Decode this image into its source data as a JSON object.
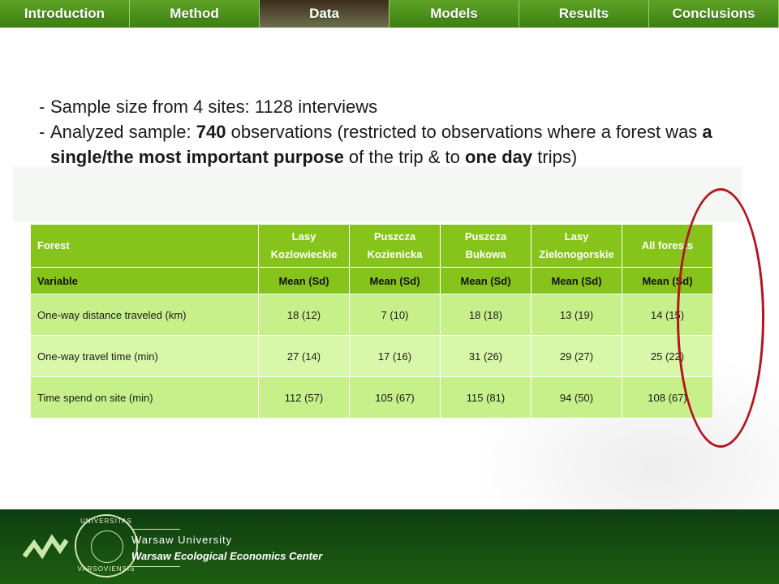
{
  "nav": {
    "tabs": [
      {
        "label": "Introduction"
      },
      {
        "label": "Method"
      },
      {
        "label": "Data"
      },
      {
        "label": "Models"
      },
      {
        "label": "Results"
      },
      {
        "label": "Conclusions"
      }
    ],
    "active_tab": "Data"
  },
  "bullets": {
    "b1": {
      "dash": "-",
      "text": "Sample size from 4 sites: 1128 interviews"
    },
    "b2": {
      "dash": "-",
      "p1": "Analyzed sample: ",
      "bold1": "740",
      "p2": " observations (restricted to observations where a forest was ",
      "bold2": "a single/the most important purpose",
      "p3": " of the trip & to ",
      "bold3": "one day",
      "p4": " trips)"
    }
  },
  "table": {
    "header": {
      "forest": "Forest",
      "cols": [
        {
          "l1": "Lasy",
          "l2": "Kozlowieckie"
        },
        {
          "l1": "Puszcza",
          "l2": "Kozienicka"
        },
        {
          "l1": "Puszcza",
          "l2": "Bukowa"
        },
        {
          "l1": "Lasy",
          "l2": "Zielonogorskie"
        },
        {
          "l1": "All forests",
          "l2": ""
        }
      ]
    },
    "subheader": {
      "variable": "Variable",
      "stats": [
        "Mean (Sd)",
        "Mean (Sd)",
        "Mean (Sd)",
        "Mean (Sd)",
        "Mean (Sd)"
      ]
    },
    "rows": [
      {
        "label": "One-way distance traveled (km)",
        "values": [
          "18 (12)",
          "7 (10)",
          "18 (18)",
          "13 (19)",
          "14 (15)"
        ]
      },
      {
        "label": "One-way travel time (min)",
        "values": [
          "27 (14)",
          "17 (16)",
          "31 (26)",
          "29 (27)",
          "25 (22)"
        ]
      },
      {
        "label": "Time spend on site (min)",
        "values": [
          "112 (57)",
          "105 (67)",
          "115 (81)",
          "94 (50)",
          "108 (67)"
        ]
      }
    ]
  },
  "footer": {
    "university": "Warsaw University",
    "center": "Warsaw Ecological Economics Center",
    "seal_top": "UNIVERSITAS",
    "seal_bottom": "VARSOVIENSIS",
    "colors": {
      "green_dark": "#0e3d10",
      "table_green": "#86c41b",
      "highlight_red": "#b3141e"
    }
  }
}
